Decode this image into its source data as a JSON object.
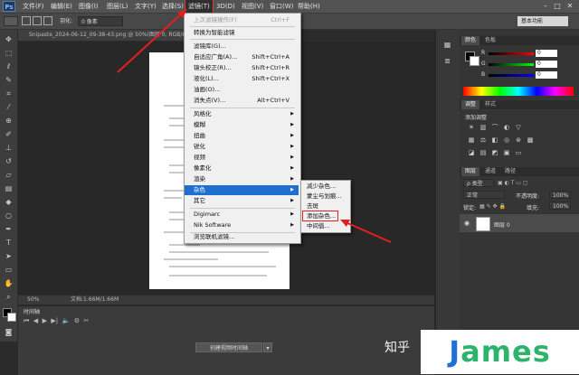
{
  "app": {
    "logo": "Ps"
  },
  "menubar": {
    "items": [
      "文件(F)",
      "编辑(E)",
      "图像(I)",
      "图层(L)",
      "文字(Y)",
      "选择(S)",
      "滤镜(T)",
      "3D(D)",
      "视图(V)",
      "窗口(W)",
      "帮助(H)"
    ],
    "active": "滤镜(T)",
    "window_buttons": [
      "–",
      "□",
      "✕"
    ]
  },
  "options_bar": {
    "feather_label": "羽化:",
    "feather_value": "0 像素",
    "workspace": "基本功能"
  },
  "document": {
    "tab_title": "Snipaste_2024-06-12_09-38-43.png @ 50%(图层 0, RGB/8)",
    "zoom": "50%",
    "doc_size": "文档:1.66M/1.66M"
  },
  "timeline": {
    "title": "时间轴",
    "create_button": "创建视频时间轴"
  },
  "filter_menu": {
    "items": [
      {
        "label": "上次滤镜操作(F)",
        "shortcut": "Ctrl+F",
        "dim": true
      },
      {
        "label": "转换为智能滤镜"
      },
      {
        "label": "滤镜库(G)..."
      },
      {
        "label": "自适应广角(A)...",
        "shortcut": "Shift+Ctrl+A"
      },
      {
        "label": "镜头校正(R)...",
        "shortcut": "Shift+Ctrl+R"
      },
      {
        "label": "液化(L)...",
        "shortcut": "Shift+Ctrl+X"
      },
      {
        "label": "油画(O)..."
      },
      {
        "label": "消失点(V)...",
        "shortcut": "Alt+Ctrl+V"
      },
      {
        "label": "风格化",
        "submenu": true
      },
      {
        "label": "模糊",
        "submenu": true
      },
      {
        "label": "扭曲",
        "submenu": true
      },
      {
        "label": "锐化",
        "submenu": true
      },
      {
        "label": "视频",
        "submenu": true
      },
      {
        "label": "像素化",
        "submenu": true
      },
      {
        "label": "渲染",
        "submenu": true
      },
      {
        "label": "杂色",
        "submenu": true,
        "highlighted": true
      },
      {
        "label": "其它",
        "submenu": true
      },
      {
        "label": "Digimarc",
        "submenu": true
      },
      {
        "label": "Nik Software",
        "submenu": true
      },
      {
        "label": "浏览联机滤镜..."
      }
    ]
  },
  "noise_submenu": {
    "items": [
      "减少杂色...",
      "蒙尘与划痕...",
      "去斑",
      "添加杂色...",
      "中间值..."
    ],
    "annotated": "添加杂色..."
  },
  "panels": {
    "color": {
      "tabs": [
        "颜色",
        "色板"
      ],
      "channels": [
        {
          "label": "R",
          "value": "0"
        },
        {
          "label": "G",
          "value": "0"
        },
        {
          "label": "B",
          "value": "0"
        }
      ]
    },
    "adjustments": {
      "tabs": [
        "调整",
        "样式"
      ],
      "header": "添加调整"
    },
    "layers": {
      "tabs": [
        "图层",
        "通道",
        "路径"
      ],
      "kind_filter": "ρ 类型",
      "blend_mode": "正常",
      "opacity_label": "不透明度:",
      "opacity_value": "100%",
      "lock_label": "锁定:",
      "fill_label": "填充:",
      "fill_value": "100%",
      "layer_name": "图层 0"
    }
  },
  "watermark": {
    "zhihu": "知乎",
    "james": "James"
  },
  "colors": {
    "accent": "#1f6fd1",
    "annotation_red": "#e02020",
    "james_blue": "#1e6fd9",
    "james_green": "#2db36b"
  }
}
